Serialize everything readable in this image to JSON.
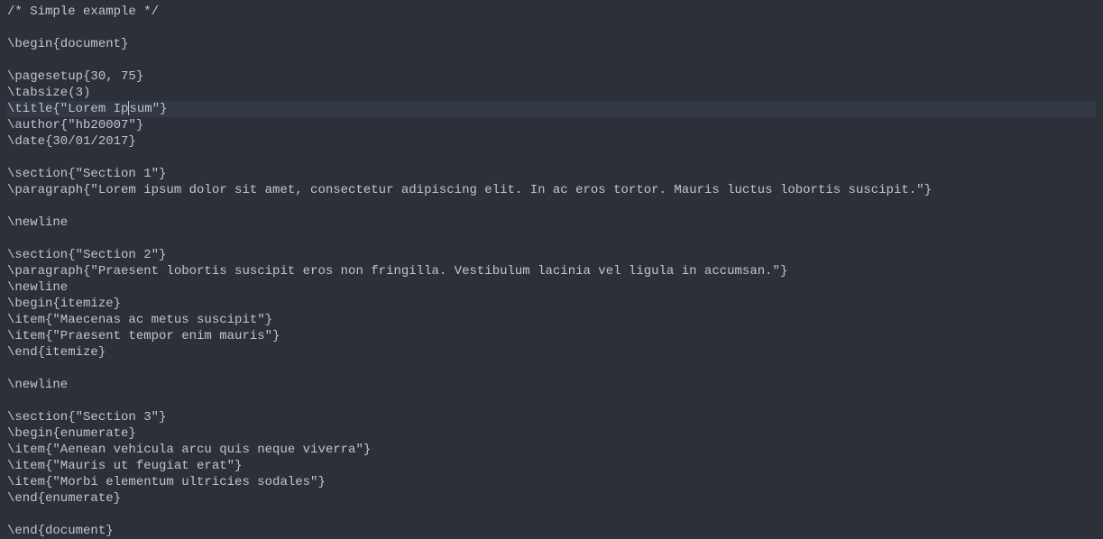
{
  "lines": [
    "/* Simple example */",
    "",
    "\\begin{document}",
    "",
    "\\pagesetup{30, 75}",
    "\\tabsize(3)",
    "\\title{\"Lorem Ipsum\"}",
    "\\author{\"hb20007\"}",
    "\\date{30/01/2017}",
    "",
    "\\section{\"Section 1\"}",
    "\\paragraph{\"Lorem ipsum dolor sit amet, consectetur adipiscing elit. In ac eros tortor. Mauris luctus lobortis suscipit.\"}",
    "",
    "\\newline",
    "",
    "\\section{\"Section 2\"}",
    "\\paragraph{\"Praesent lobortis suscipit eros non fringilla. Vestibulum lacinia vel ligula in accumsan.\"}",
    "\\newline",
    "\\begin{itemize}",
    "\\item{\"Maecenas ac metus suscipit\"}",
    "\\item{\"Praesent tempor enim mauris\"}",
    "\\end{itemize}",
    "",
    "\\newline",
    "",
    "\\section{\"Section 3\"}",
    "\\begin{enumerate}",
    "\\item{\"Aenean vehicula arcu quis neque viverra\"}",
    "\\item{\"Mauris ut feugiat erat\"}",
    "\\item{\"Morbi elementum ultricies sodales\"}",
    "\\end{enumerate}",
    "",
    "\\end{document}"
  ],
  "highlightedLine": 6,
  "cursorLine": 6,
  "cursorCol": 16
}
